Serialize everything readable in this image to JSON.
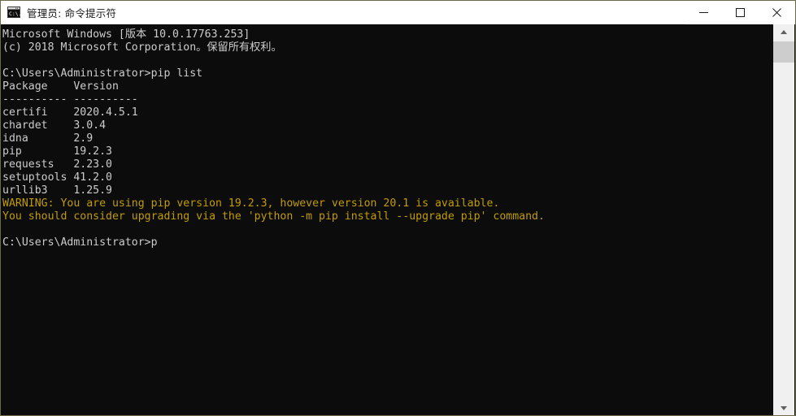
{
  "window": {
    "title": "管理员: 命令提示符",
    "icon": "command-prompt-icon",
    "background_color": "#0c0c0c",
    "titlebar_color": "#ffffff",
    "border_color": "#6b6b4a"
  },
  "titlebar": {
    "minimize_glyph": "minimize-icon",
    "maximize_glyph": "maximize-icon",
    "close_glyph": "close-icon"
  },
  "console": {
    "text_color": "#cccccc",
    "warning_color": "#c19c00",
    "lines": [
      {
        "text": "Microsoft Windows [版本 10.0.17763.253]",
        "color": "default"
      },
      {
        "text": "(c) 2018 Microsoft Corporation。保留所有权利。",
        "color": "default"
      },
      {
        "text": "",
        "color": "default"
      },
      {
        "text": "C:\\Users\\Administrator>pip list",
        "color": "default"
      },
      {
        "text": "Package    Version",
        "color": "default"
      },
      {
        "text": "---------- ----------",
        "color": "default"
      },
      {
        "text": "certifi    2020.4.5.1",
        "color": "default"
      },
      {
        "text": "chardet    3.0.4",
        "color": "default"
      },
      {
        "text": "idna       2.9",
        "color": "default"
      },
      {
        "text": "pip        19.2.3",
        "color": "default"
      },
      {
        "text": "requests   2.23.0",
        "color": "default"
      },
      {
        "text": "setuptools 41.2.0",
        "color": "default"
      },
      {
        "text": "urllib3    1.25.9",
        "color": "default"
      },
      {
        "text": "WARNING: You are using pip version 19.2.3, however version 20.1 is available.",
        "color": "warning"
      },
      {
        "text": "You should consider upgrading via the 'python -m pip install --upgrade pip' command.",
        "color": "warning"
      },
      {
        "text": "",
        "color": "default"
      },
      {
        "text": "C:\\Users\\Administrator>p",
        "color": "default"
      }
    ],
    "command_entered": "pip list",
    "prompt": "C:\\Users\\Administrator>",
    "current_input": "p",
    "package_table": {
      "headers": [
        "Package",
        "Version"
      ],
      "rows": [
        [
          "certifi",
          "2020.4.5.1"
        ],
        [
          "chardet",
          "3.0.4"
        ],
        [
          "idna",
          "2.9"
        ],
        [
          "pip",
          "19.2.3"
        ],
        [
          "requests",
          "2.23.0"
        ],
        [
          "setuptools",
          "41.2.0"
        ],
        [
          "urllib3",
          "1.25.9"
        ]
      ]
    }
  },
  "scrollbar": {
    "up_arrow": "scroll-up-icon",
    "down_arrow": "scroll-down-icon",
    "track_color": "#f0f0f0",
    "thumb_color": "#cdcdcd"
  }
}
